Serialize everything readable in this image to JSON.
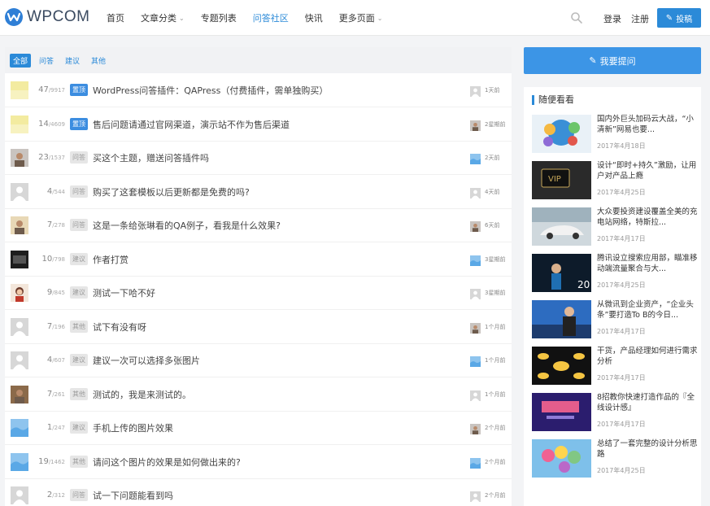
{
  "colors": {
    "accent": "#2b8ad8",
    "button": "#3c95e6"
  },
  "brand": {
    "name": "WPCOM",
    "icon": "wpcom-logo-icon"
  },
  "nav": [
    {
      "label": "首页",
      "active": false,
      "dropdown": false
    },
    {
      "label": "文章分类",
      "active": false,
      "dropdown": true
    },
    {
      "label": "专题列表",
      "active": false,
      "dropdown": false
    },
    {
      "label": "问答社区",
      "active": true,
      "dropdown": false
    },
    {
      "label": "快讯",
      "active": false,
      "dropdown": false
    },
    {
      "label": "更多页面",
      "active": false,
      "dropdown": true
    }
  ],
  "header": {
    "login": "登录",
    "register": "注册",
    "post_button": "投稿"
  },
  "tabs": [
    "全部",
    "问答",
    "建议",
    "其他"
  ],
  "questions": [
    {
      "answers": "47",
      "views": "9917",
      "tag": "置顶",
      "tag_style": "blue",
      "title": "WordPress问答插件：QAPress（付费插件，需单独购买）",
      "time": "1天前",
      "avatar": "yellow"
    },
    {
      "answers": "14",
      "views": "4609",
      "tag": "置顶",
      "tag_style": "blue",
      "title": "售后问题请通过官网渠道，演示站不作为售后渠道",
      "time": "2星期前",
      "avatar": "yellow"
    },
    {
      "answers": "23",
      "views": "1537",
      "tag": "问答",
      "tag_style": "gray",
      "title": "买这个主题，赠送问答插件吗",
      "time": "2天前",
      "avatar": "photo1"
    },
    {
      "answers": "4",
      "views": "544",
      "tag": "问答",
      "tag_style": "gray",
      "title": "购买了这套模板以后更新都是免费的吗?",
      "time": "4天前",
      "avatar": "default"
    },
    {
      "answers": "7",
      "views": "278",
      "tag": "问答",
      "tag_style": "gray",
      "title": "这是一条给张琳看的QA例子，看我是什么效果?",
      "time": "6天前",
      "avatar": "photo2"
    },
    {
      "answers": "10",
      "views": "798",
      "tag": "建议",
      "tag_style": "gray",
      "title": "作者打赏",
      "time": "3星期前",
      "avatar": "dark"
    },
    {
      "answers": "9",
      "views": "845",
      "tag": "建议",
      "tag_style": "gray",
      "title": "测试一下哈不好",
      "time": "3星期前",
      "avatar": "girl"
    },
    {
      "answers": "7",
      "views": "196",
      "tag": "其他",
      "tag_style": "gray",
      "title": "试下有没有呀",
      "time": "1个月前",
      "avatar": "default"
    },
    {
      "answers": "4",
      "views": "607",
      "tag": "建议",
      "tag_style": "gray",
      "title": "建议一次可以选择多张图片",
      "time": "1个月前",
      "avatar": "default"
    },
    {
      "answers": "7",
      "views": "261",
      "tag": "其他",
      "tag_style": "gray",
      "title": "测试的，我是来测试的。",
      "time": "1个月前",
      "avatar": "photo3"
    },
    {
      "answers": "1",
      "views": "247",
      "tag": "建议",
      "tag_style": "gray",
      "title": "手机上传的图片效果",
      "time": "2个月前",
      "avatar": "blue"
    },
    {
      "answers": "19",
      "views": "1462",
      "tag": "其他",
      "tag_style": "gray",
      "title": "请问这个图片的效果是如何做出来的?",
      "time": "2个月前",
      "avatar": "blue"
    },
    {
      "answers": "2",
      "views": "312",
      "tag": "问答",
      "tag_style": "gray",
      "title": "试一下问题能看到吗",
      "time": "2个月前",
      "avatar": "default"
    }
  ],
  "sidebar": {
    "ask_button": "我要提问",
    "widget_title": "随便看看",
    "articles": [
      {
        "title": "国内外巨头加码云大战，“小清新”网易也要...",
        "date": "2017年4月18日",
        "thumb": "cloud"
      },
      {
        "title": "设计“即时+持久”激励，让用户对产品上瘾",
        "date": "2017年4月25日",
        "thumb": "vip"
      },
      {
        "title": "大众要投资建设覆盖全美的充电站网络，特斯拉...",
        "date": "2017年4月17日",
        "thumb": "car"
      },
      {
        "title": "腾讯设立搜索应用部，瞄准移动端流量聚合与大...",
        "date": "2017年4月25日",
        "thumb": "stage"
      },
      {
        "title": "从微讯到企业资产，“企业头条”要打造To B的今日...",
        "date": "2017年4月17日",
        "thumb": "presenter"
      },
      {
        "title": "干货，产品经理如何进行需求分析",
        "date": "2017年4月17日",
        "thumb": "mindmap"
      },
      {
        "title": "8招教你快速打造作品的『全线设计感』",
        "date": "2017年4月17日",
        "thumb": "purple"
      },
      {
        "title": "总结了一套完整的设计分析思路",
        "date": "2017年4月25日",
        "thumb": "balloons"
      }
    ]
  }
}
